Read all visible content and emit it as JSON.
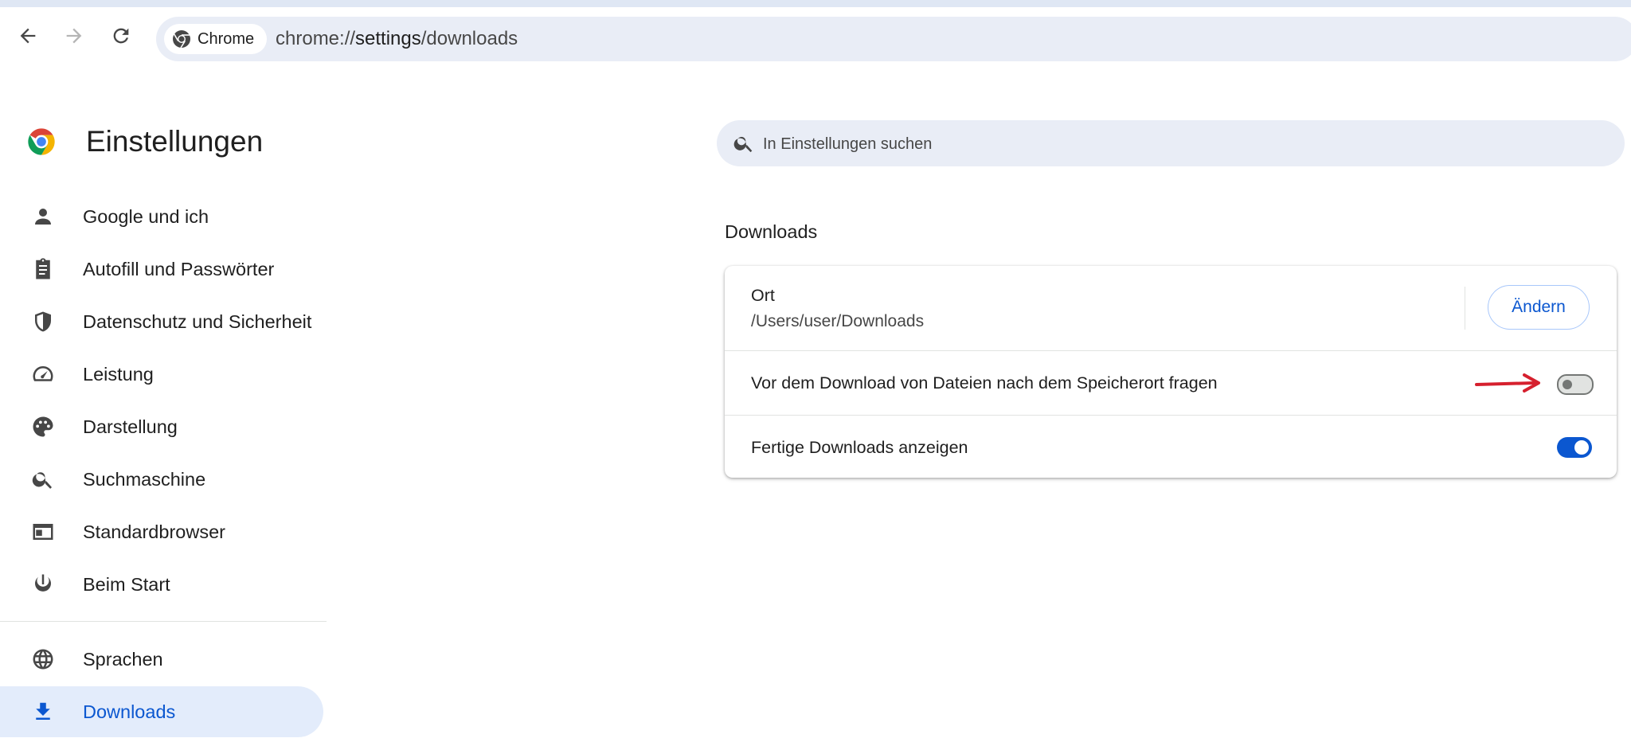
{
  "browser": {
    "chip_label": "Chrome",
    "url_scheme": "chrome://",
    "url_host": "settings",
    "url_path": "/downloads"
  },
  "app": {
    "title": "Einstellungen"
  },
  "sidebar": {
    "items": [
      {
        "label": "Google und ich",
        "icon": "person-icon"
      },
      {
        "label": "Autofill und Passwörter",
        "icon": "clipboard-icon"
      },
      {
        "label": "Datenschutz und Sicherheit",
        "icon": "shield-icon"
      },
      {
        "label": "Leistung",
        "icon": "speedometer-icon"
      },
      {
        "label": "Darstellung",
        "icon": "palette-icon"
      },
      {
        "label": "Suchmaschine",
        "icon": "search-icon"
      },
      {
        "label": "Standardbrowser",
        "icon": "browser-window-icon"
      },
      {
        "label": "Beim Start",
        "icon": "power-icon"
      },
      {
        "label": "Sprachen",
        "icon": "globe-icon"
      },
      {
        "label": "Downloads",
        "icon": "download-icon",
        "active": true
      }
    ]
  },
  "search": {
    "placeholder": "In Einstellungen suchen"
  },
  "section": {
    "title": "Downloads"
  },
  "settings": {
    "location": {
      "label": "Ort",
      "value": "/Users/user/Downloads",
      "button_label": "Ändern"
    },
    "ask_where": {
      "label": "Vor dem Download von Dateien nach dem Speicherort fragen",
      "enabled": false
    },
    "show_finished": {
      "label": "Fertige Downloads anzeigen",
      "enabled": true
    }
  },
  "colors": {
    "accent": "#0b57d0",
    "annotation_arrow": "#d6202e",
    "active_nav_bg": "#e3ecfb"
  }
}
